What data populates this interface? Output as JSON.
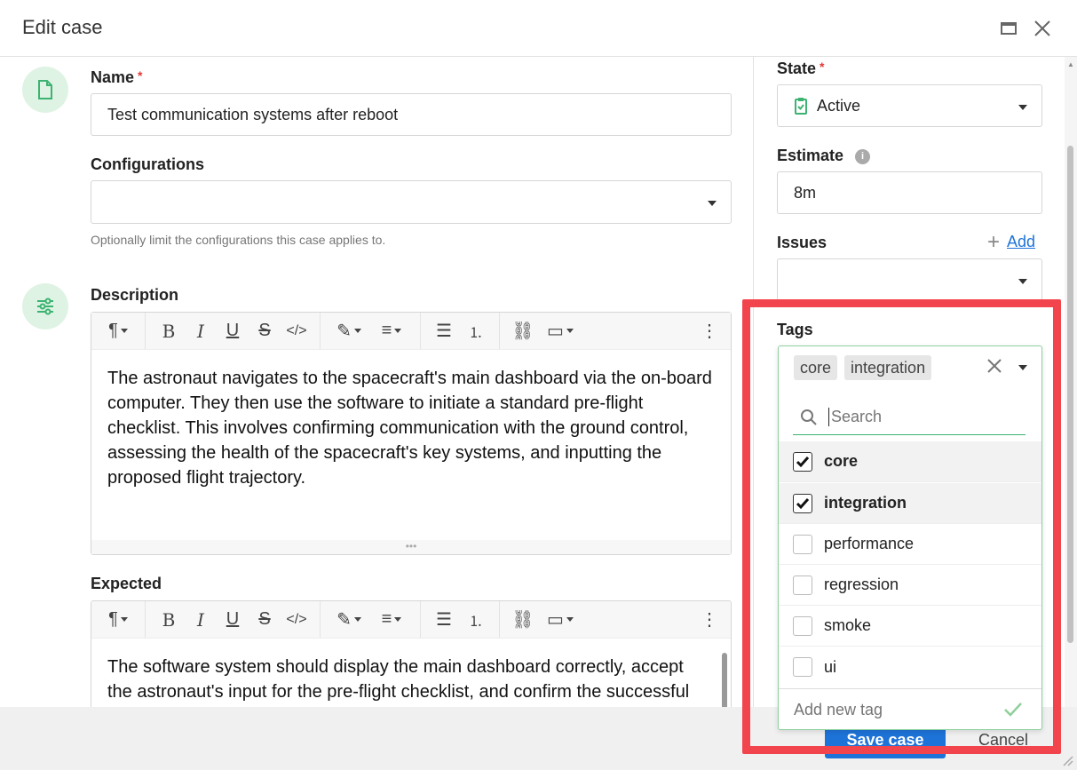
{
  "dialog": {
    "title": "Edit case"
  },
  "name": {
    "label": "Name",
    "required_mark": "*",
    "value": "Test communication systems after reboot"
  },
  "configurations": {
    "label": "Configurations",
    "value": "",
    "help": "Optionally limit the configurations this case applies to."
  },
  "description": {
    "label": "Description",
    "text": "The astronaut navigates to the spacecraft's main dashboard via the on-board computer. They then use the software to initiate a standard pre-flight checklist. This involves confirming communication with the ground control, assessing the health of the spacecraft's key systems, and inputting the proposed flight trajectory."
  },
  "expected": {
    "label": "Expected",
    "text": "The software system should display the main dashboard correctly, accept the astronaut's input for the pre-flight checklist, and confirm the successful"
  },
  "toolbar": {
    "icons": [
      "paragraph-icon",
      "bold-icon",
      "italic-icon",
      "underline-icon",
      "strikethrough-icon",
      "code-icon",
      "highlight-icon",
      "align-icon",
      "bullet-list-icon",
      "numbered-list-icon",
      "link-icon",
      "embed-icon",
      "more-icon"
    ],
    "bold": "B",
    "italic": "I",
    "underline": "U",
    "strike": "S"
  },
  "state": {
    "label": "State",
    "required_mark": "*",
    "value": "Active"
  },
  "estimate": {
    "label": "Estimate",
    "value": "8m"
  },
  "issues": {
    "label": "Issues",
    "add_label": "Add",
    "value": ""
  },
  "tags": {
    "label": "Tags",
    "selected": [
      "core",
      "integration"
    ],
    "search_placeholder": "Search",
    "options": [
      {
        "label": "core",
        "checked": true
      },
      {
        "label": "integration",
        "checked": true
      },
      {
        "label": "performance",
        "checked": false
      },
      {
        "label": "regression",
        "checked": false
      },
      {
        "label": "smoke",
        "checked": false
      },
      {
        "label": "ui",
        "checked": false
      }
    ],
    "add_new_placeholder": "Add new tag"
  },
  "footer": {
    "save_label": "Save case",
    "cancel_label": "Cancel"
  },
  "colors": {
    "accent_green": "#3cb371",
    "primary_blue": "#1e73d8",
    "highlight_red": "#f2444c"
  }
}
